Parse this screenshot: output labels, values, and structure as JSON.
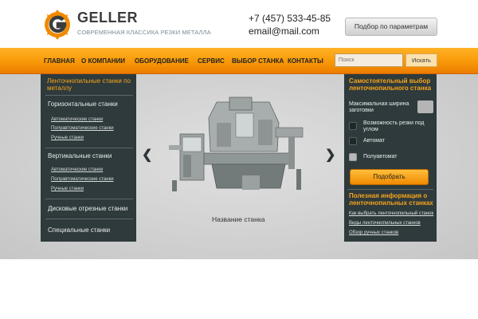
{
  "header": {
    "brand": "GELLER",
    "tagline": "СОВРЕМЕННАЯ КЛАССИКА РЕЗКИ МЕТАЛЛА",
    "phone": "+7 (457) 533-45-85",
    "email": "email@mail.com",
    "param_button": "Подбор по параметрам"
  },
  "nav": {
    "items": [
      "ГЛАВНАЯ",
      "О КОМПАНИИ",
      "ОБОРУДОВАНИЕ",
      "СЕРВИС",
      "ВЫБОР СТАНКА",
      "КОНТАКТЫ"
    ],
    "search_placeholder": "Поиск",
    "search_button": "Искать"
  },
  "left_panel": {
    "title": "Ленточнопильные станки по металлу",
    "cat_horizontal": "Горизонтальные станки",
    "horizontal_subs": [
      "Автоматические станки",
      "Полуавтоматические станки",
      "Ручные станки"
    ],
    "cat_vertical": "Вертикальные станки",
    "vertical_subs": [
      "Автоматические станки",
      "Полуавтоматические станки",
      "Ручные станки"
    ],
    "cat_disc": "Дисковые отрезные станки",
    "cat_special": "Специальные станки"
  },
  "slider": {
    "caption": "Название станка",
    "prev_icon": "chevron-left-icon",
    "next_icon": "chevron-right-icon"
  },
  "right_panel": {
    "title": "Самостоятельный выбор ленточнопильного станка",
    "width_label": "Максимальная ширина заготовки",
    "options": [
      {
        "label": "Возможность резки под углом",
        "checked": false
      },
      {
        "label": "Автомат",
        "checked": false
      },
      {
        "label": "Полуавтомат",
        "checked": true
      }
    ],
    "pick_button": "Подобрать",
    "info_title": "Полезная информация о ленточнопильных станках",
    "links": [
      "Как выбрать ленточнопильный станок",
      "Виды ленточнопильных станков",
      "Обзор ручных станков"
    ]
  },
  "colors": {
    "accent_orange": "#f89908",
    "panel_bg": "#2e3a3c",
    "panel_title": "#f7a51c"
  }
}
